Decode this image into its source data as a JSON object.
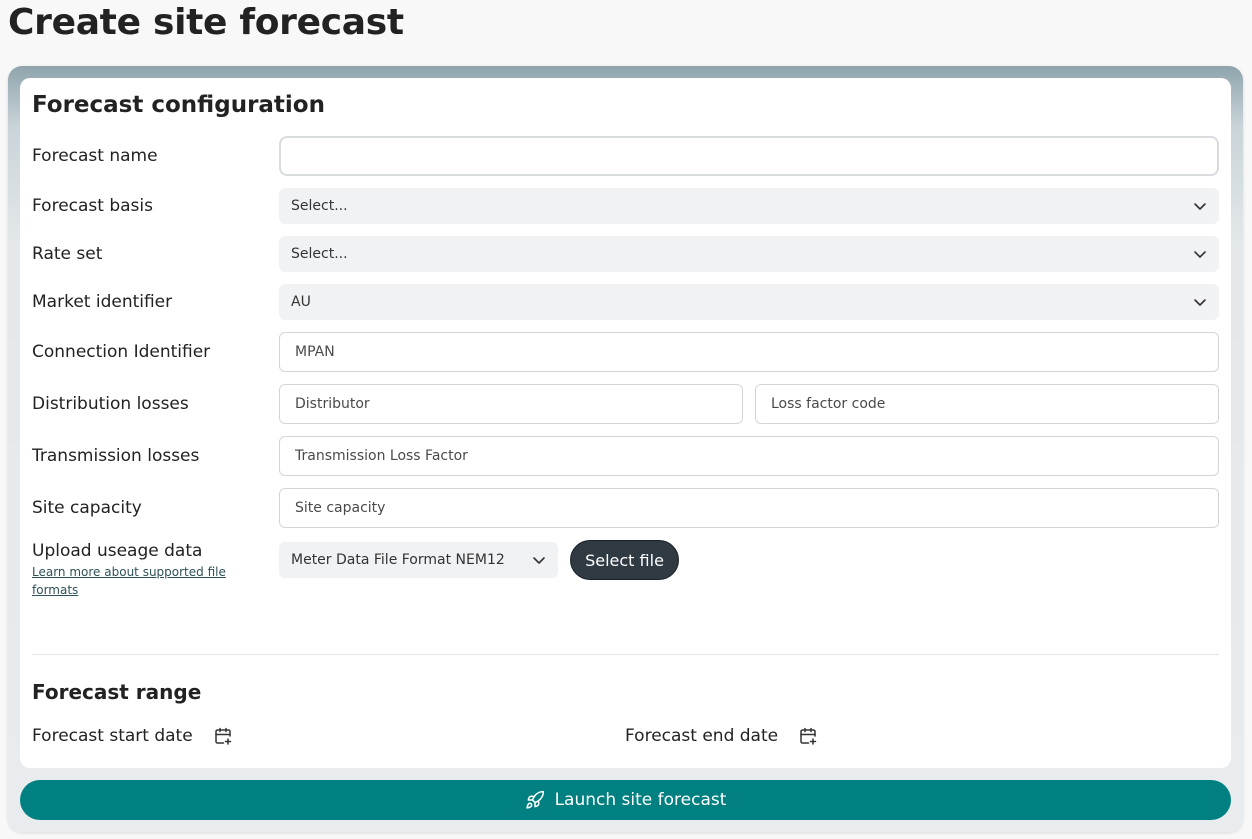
{
  "page": {
    "title": "Create site forecast"
  },
  "config": {
    "title": "Forecast configuration",
    "forecast_name": {
      "label": "Forecast name",
      "value": "",
      "placeholder": ""
    },
    "forecast_basis": {
      "label": "Forecast basis",
      "value": "Select..."
    },
    "rate_set": {
      "label": "Rate set",
      "value": "Select..."
    },
    "market_identifier": {
      "label": "Market identifier",
      "value": "AU"
    },
    "connection_identifier": {
      "label": "Connection Identifier",
      "placeholder": "MPAN"
    },
    "distribution_losses": {
      "label": "Distribution losses",
      "distributor_placeholder": "Distributor",
      "loss_factor_placeholder": "Loss factor code"
    },
    "transmission_losses": {
      "label": "Transmission losses",
      "placeholder": "Transmission Loss Factor"
    },
    "site_capacity": {
      "label": "Site capacity",
      "placeholder": "Site capacity"
    },
    "upload": {
      "label": "Upload useage data",
      "link": "Learn more about supported file formats",
      "format_value": "Meter Data File Format NEM12",
      "select_file_label": "Select file"
    }
  },
  "range": {
    "title": "Forecast range",
    "start_label": "Forecast start date",
    "end_label": "Forecast end date"
  },
  "actions": {
    "launch_label": "Launch site forecast"
  },
  "icons": {
    "chevron": "chevron-down-icon",
    "calendar": "calendar-plus-icon",
    "rocket": "rocket-icon"
  },
  "colors": {
    "accent": "#008080",
    "dark_button": "#2f3a42",
    "link": "#2f5159"
  }
}
